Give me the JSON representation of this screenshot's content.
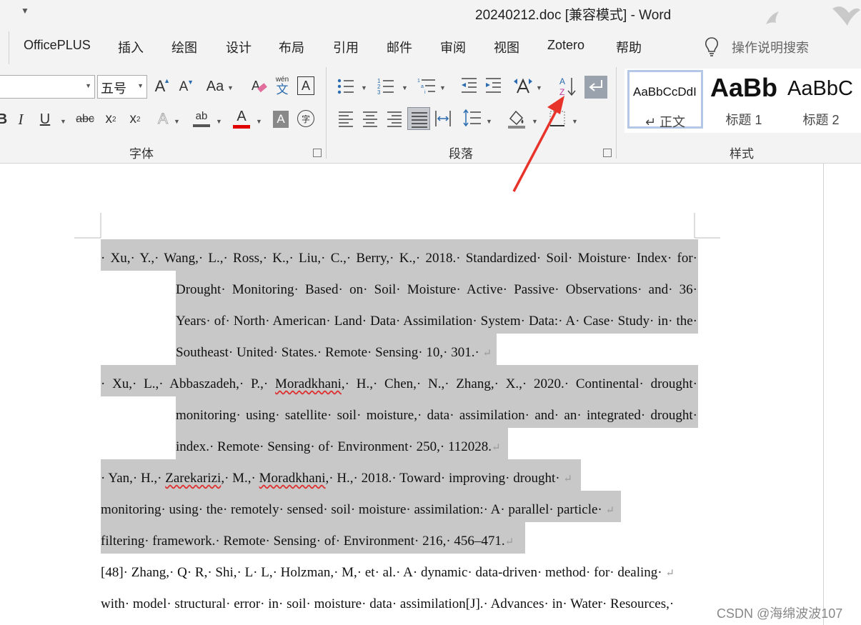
{
  "title_bar": {
    "title": "20240212.doc [兼容模式]  -  Word",
    "qa_caret": "▼"
  },
  "menu": {
    "tabs": [
      "OfficePLUS",
      "插入",
      "绘图",
      "设计",
      "布局",
      "引用",
      "邮件",
      "审阅",
      "视图",
      "Zotero",
      "帮助"
    ],
    "tell_me_placeholder": "操作说明搜索"
  },
  "ribbon": {
    "font_name": "",
    "font_size": "五号",
    "groups": {
      "font": "字体",
      "paragraph": "段落",
      "styles": "样式"
    },
    "font_buttons": {
      "grow": "A",
      "shrink": "A",
      "change_case": "Aa",
      "pinyin_top": "wén",
      "pinyin_bottom": "文",
      "border": "A",
      "italic": "I",
      "underline": "U",
      "strike": "abc",
      "subscript": "x",
      "superscript": "x",
      "text_effects": "A",
      "highlight": "ab",
      "font_color": "A",
      "shading": "A",
      "enclose": "字"
    },
    "styles_gallery": [
      {
        "preview": "AaBbCcDdI",
        "name": "↵ 正文"
      },
      {
        "preview": "AaBb",
        "name": "标题 1"
      },
      {
        "preview": "AaBbC",
        "name": "标题 2"
      }
    ]
  },
  "document": {
    "ref1": [
      "· Xu,· Y.,· Wang,· L.,· Ross,· K.,· Liu,· C.,· Berry,· K.,· 2018.· Standardized· Soil· Moisture· Index· for·",
      "Drought· Monitoring· Based· on· Soil· Moisture· Active· Passive· Observations· and· 36·",
      "Years· of· North· American· Land· Data· Assimilation· System· Data:· A· Case· Study· in· the·",
      "Southeast· United· States.· Remote· Sensing· 10,· 301.· "
    ],
    "ref2_line1_a": "· Xu,· L.,· Abbaszadeh,· P.,· ",
    "ref2_line1_b": "Moradkhani",
    "ref2_line1_c": ",· H.,· Chen,· N.,· Zhang,· X.,· 2020.· Continental· drought·",
    "ref2_line2": "monitoring· using· satellite· soil· moisture,· data· assimilation· and· an· integrated· drought·",
    "ref2_line3": "index.· Remote· Sensing· of· Environment· 250,· 112028.",
    "ref3_line1_a": "· Yan,· H.,· ",
    "ref3_line1_b": "Zarekarizi",
    "ref3_line1_c": ",· M.,· ",
    "ref3_line1_d": "Moradkhani",
    "ref3_line1_e": ",· H.,· 2018.· Toward· improving· drought· ",
    "ref3_line2": "monitoring· using· the· remotely· sensed· soil· moisture· assimilation:· A· parallel· particle· ",
    "ref3_line3": "filtering· framework.· Remote· Sensing· of· Environment· 216,· 456–471.",
    "ref4_line1": "[48]· Zhang,· Q· R,· Shi,· L· L,· Holzman,· M,· et· al.· A· dynamic· data-driven· method· for· dealing· ",
    "ref4_line2": "with· model· structural· error· in· soil· moisture· data· assimilation[J].· Advances· in· Water· Resources,·",
    "para_mark": "↵"
  },
  "watermark": "CSDN @海绵波波107",
  "colors": {
    "ribbon_bg": "#f3f3f3",
    "selection": "#c8c8c8",
    "arrow": "#e8332a",
    "font_color_bar": "#e00000"
  }
}
